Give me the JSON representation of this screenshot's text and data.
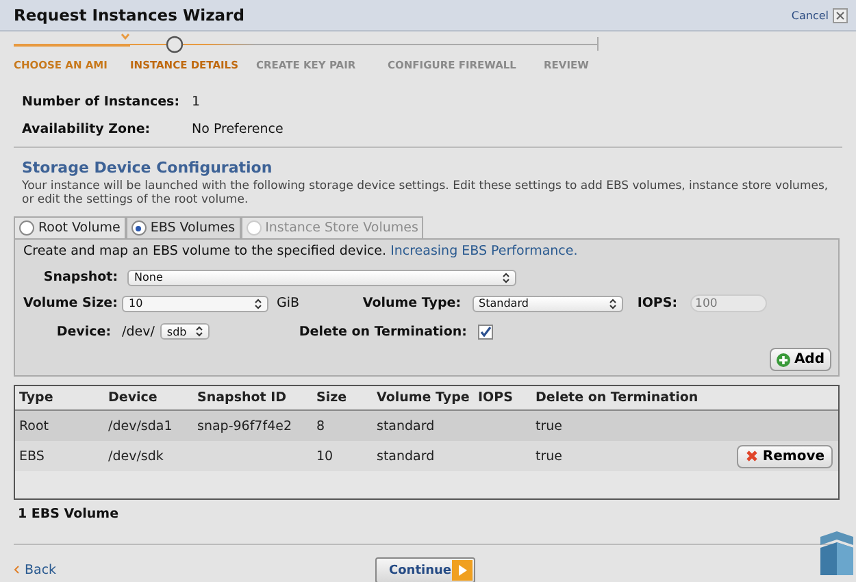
{
  "window": {
    "title": "Request Instances Wizard",
    "cancel": "Cancel"
  },
  "steps": [
    {
      "label": "CHOOSE AN AMI",
      "completed": true,
      "current": false
    },
    {
      "label": "INSTANCE DETAILS",
      "completed": false,
      "current": true
    },
    {
      "label": "CREATE KEY PAIR",
      "completed": false,
      "current": false
    },
    {
      "label": "CONFIGURE FIREWALL",
      "completed": false,
      "current": false
    },
    {
      "label": "REVIEW",
      "completed": false,
      "current": false
    }
  ],
  "summary": [
    {
      "label": "Number of Instances:",
      "value": "1"
    },
    {
      "label": "Availability Zone:",
      "value": "No Preference"
    }
  ],
  "storage": {
    "title": "Storage Device Configuration",
    "description": "Your instance will be launched with the following storage device settings. Edit these settings to add EBS volumes, instance store volumes, or edit the settings of the root volume.",
    "tabs": [
      {
        "label": "Root Volume",
        "selected": false,
        "disabled": false
      },
      {
        "label": "EBS Volumes",
        "selected": true,
        "disabled": false
      },
      {
        "label": "Instance Store Volumes",
        "selected": false,
        "disabled": true
      }
    ],
    "intro": "Create and map an EBS volume to the specified device.",
    "link": "Increasing EBS Performance.",
    "snapshot": {
      "label": "Snapshot:",
      "value": "None"
    },
    "volume_size": {
      "label": "Volume Size:",
      "value": "10",
      "unit": "GiB"
    },
    "volume_type": {
      "label": "Volume Type:",
      "value": "Standard"
    },
    "iops": {
      "label": "IOPS:",
      "placeholder": "100",
      "disabled": true
    },
    "device": {
      "label": "Device:",
      "prefix": "/dev/",
      "value": "sdb"
    },
    "delete_on_termination": {
      "label": "Delete on Termination:",
      "checked": true
    },
    "add_button": "Add"
  },
  "table": {
    "columns": [
      "Type",
      "Device",
      "Snapshot ID",
      "Size",
      "Volume Type",
      "IOPS",
      "Delete on Termination"
    ],
    "rows": [
      {
        "cells": [
          "Root",
          "/dev/sda1",
          "snap-96f7f4e2",
          "8",
          "standard",
          "",
          "true"
        ]
      },
      {
        "cells": [
          "EBS",
          "/dev/sdk",
          "",
          "10",
          "standard",
          "",
          "true"
        ],
        "remove_button": "Remove"
      }
    ]
  },
  "count": "1 EBS Volume",
  "footer": {
    "back": "Back",
    "continue": "Continue"
  }
}
